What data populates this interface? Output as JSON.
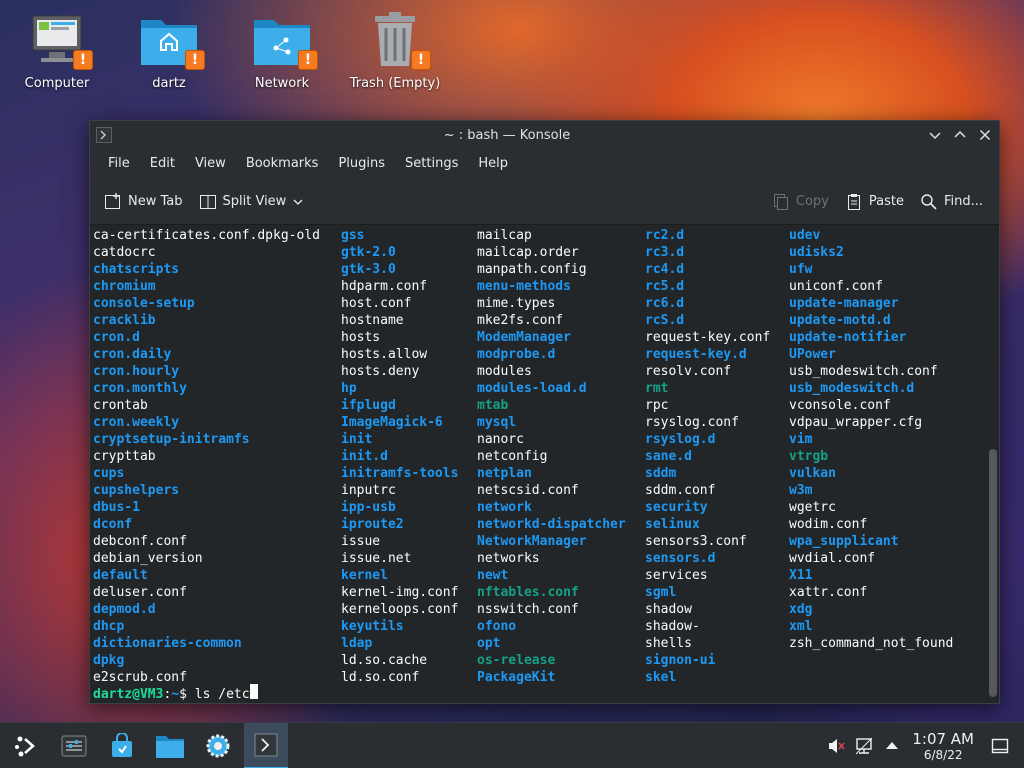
{
  "desktop": {
    "icons": [
      {
        "label": "Computer"
      },
      {
        "label": "dartz"
      },
      {
        "label": "Network"
      },
      {
        "label": "Trash (Empty)"
      }
    ],
    "badge_glyph": "!"
  },
  "window": {
    "title": "~ : bash — Konsole",
    "menu": [
      "File",
      "Edit",
      "View",
      "Bookmarks",
      "Plugins",
      "Settings",
      "Help"
    ],
    "toolbar": {
      "new_tab": "New Tab",
      "split_view": "Split View",
      "copy": "Copy",
      "paste": "Paste",
      "find": "Find..."
    }
  },
  "terminal": {
    "columns": [
      [
        {
          "t": "ca-certificates.conf.dpkg-old",
          "k": "plain"
        },
        {
          "t": "catdocrc",
          "k": "plain"
        },
        {
          "t": "chatscripts",
          "k": "dir"
        },
        {
          "t": "chromium",
          "k": "dir"
        },
        {
          "t": "console-setup",
          "k": "dir"
        },
        {
          "t": "cracklib",
          "k": "dir"
        },
        {
          "t": "cron.d",
          "k": "dir"
        },
        {
          "t": "cron.daily",
          "k": "dir"
        },
        {
          "t": "cron.hourly",
          "k": "dir"
        },
        {
          "t": "cron.monthly",
          "k": "dir"
        },
        {
          "t": "crontab",
          "k": "plain"
        },
        {
          "t": "cron.weekly",
          "k": "dir"
        },
        {
          "t": "cryptsetup-initramfs",
          "k": "dir"
        },
        {
          "t": "crypttab",
          "k": "plain"
        },
        {
          "t": "cups",
          "k": "dir"
        },
        {
          "t": "cupshelpers",
          "k": "dir"
        },
        {
          "t": "dbus-1",
          "k": "dir"
        },
        {
          "t": "dconf",
          "k": "dir"
        },
        {
          "t": "debconf.conf",
          "k": "plain"
        },
        {
          "t": "debian_version",
          "k": "plain"
        },
        {
          "t": "default",
          "k": "dir"
        },
        {
          "t": "deluser.conf",
          "k": "plain"
        },
        {
          "t": "depmod.d",
          "k": "dir"
        },
        {
          "t": "dhcp",
          "k": "dir"
        },
        {
          "t": "dictionaries-common",
          "k": "dir"
        },
        {
          "t": "dpkg",
          "k": "dir"
        },
        {
          "t": "e2scrub.conf",
          "k": "plain"
        }
      ],
      [
        {
          "t": "gss",
          "k": "dir"
        },
        {
          "t": "gtk-2.0",
          "k": "dir"
        },
        {
          "t": "gtk-3.0",
          "k": "dir"
        },
        {
          "t": "hdparm.conf",
          "k": "plain"
        },
        {
          "t": "host.conf",
          "k": "plain"
        },
        {
          "t": "hostname",
          "k": "plain"
        },
        {
          "t": "hosts",
          "k": "plain"
        },
        {
          "t": "hosts.allow",
          "k": "plain"
        },
        {
          "t": "hosts.deny",
          "k": "plain"
        },
        {
          "t": "hp",
          "k": "dir"
        },
        {
          "t": "ifplugd",
          "k": "dir"
        },
        {
          "t": "ImageMagick-6",
          "k": "dir"
        },
        {
          "t": "init",
          "k": "dir"
        },
        {
          "t": "init.d",
          "k": "dir"
        },
        {
          "t": "initramfs-tools",
          "k": "dir"
        },
        {
          "t": "inputrc",
          "k": "plain"
        },
        {
          "t": "ipp-usb",
          "k": "dir"
        },
        {
          "t": "iproute2",
          "k": "dir"
        },
        {
          "t": "issue",
          "k": "plain"
        },
        {
          "t": "issue.net",
          "k": "plain"
        },
        {
          "t": "kernel",
          "k": "dir"
        },
        {
          "t": "kernel-img.conf",
          "k": "plain"
        },
        {
          "t": "kerneloops.conf",
          "k": "plain"
        },
        {
          "t": "keyutils",
          "k": "dir"
        },
        {
          "t": "ldap",
          "k": "dir"
        },
        {
          "t": "ld.so.cache",
          "k": "plain"
        },
        {
          "t": "ld.so.conf",
          "k": "plain"
        }
      ],
      [
        {
          "t": "mailcap",
          "k": "plain"
        },
        {
          "t": "mailcap.order",
          "k": "plain"
        },
        {
          "t": "manpath.config",
          "k": "plain"
        },
        {
          "t": "menu-methods",
          "k": "dir"
        },
        {
          "t": "mime.types",
          "k": "plain"
        },
        {
          "t": "mke2fs.conf",
          "k": "plain"
        },
        {
          "t": "ModemManager",
          "k": "dir"
        },
        {
          "t": "modprobe.d",
          "k": "dir"
        },
        {
          "t": "modules",
          "k": "plain"
        },
        {
          "t": "modules-load.d",
          "k": "dir"
        },
        {
          "t": "mtab",
          "k": "cyan"
        },
        {
          "t": "mysql",
          "k": "dir"
        },
        {
          "t": "nanorc",
          "k": "plain"
        },
        {
          "t": "netconfig",
          "k": "plain"
        },
        {
          "t": "netplan",
          "k": "dir"
        },
        {
          "t": "netscsid.conf",
          "k": "plain"
        },
        {
          "t": "network",
          "k": "dir"
        },
        {
          "t": "networkd-dispatcher",
          "k": "dir"
        },
        {
          "t": "NetworkManager",
          "k": "dir"
        },
        {
          "t": "networks",
          "k": "plain"
        },
        {
          "t": "newt",
          "k": "dir"
        },
        {
          "t": "nftables.conf",
          "k": "cyan"
        },
        {
          "t": "nsswitch.conf",
          "k": "plain"
        },
        {
          "t": "ofono",
          "k": "dir"
        },
        {
          "t": "opt",
          "k": "dir"
        },
        {
          "t": "os-release",
          "k": "cyan"
        },
        {
          "t": "PackageKit",
          "k": "dir"
        }
      ],
      [
        {
          "t": "rc2.d",
          "k": "dir"
        },
        {
          "t": "rc3.d",
          "k": "dir"
        },
        {
          "t": "rc4.d",
          "k": "dir"
        },
        {
          "t": "rc5.d",
          "k": "dir"
        },
        {
          "t": "rc6.d",
          "k": "dir"
        },
        {
          "t": "rcS.d",
          "k": "dir"
        },
        {
          "t": "request-key.conf",
          "k": "plain"
        },
        {
          "t": "request-key.d",
          "k": "dir"
        },
        {
          "t": "resolv.conf",
          "k": "plain"
        },
        {
          "t": "rmt",
          "k": "cyan"
        },
        {
          "t": "rpc",
          "k": "plain"
        },
        {
          "t": "rsyslog.conf",
          "k": "plain"
        },
        {
          "t": "rsyslog.d",
          "k": "dir"
        },
        {
          "t": "sane.d",
          "k": "dir"
        },
        {
          "t": "sddm",
          "k": "dir"
        },
        {
          "t": "sddm.conf",
          "k": "plain"
        },
        {
          "t": "security",
          "k": "dir"
        },
        {
          "t": "selinux",
          "k": "dir"
        },
        {
          "t": "sensors3.conf",
          "k": "plain"
        },
        {
          "t": "sensors.d",
          "k": "dir"
        },
        {
          "t": "services",
          "k": "plain"
        },
        {
          "t": "sgml",
          "k": "dir"
        },
        {
          "t": "shadow",
          "k": "plain"
        },
        {
          "t": "shadow-",
          "k": "plain"
        },
        {
          "t": "shells",
          "k": "plain"
        },
        {
          "t": "signon-ui",
          "k": "dir"
        },
        {
          "t": "skel",
          "k": "dir"
        }
      ],
      [
        {
          "t": "udev",
          "k": "dir"
        },
        {
          "t": "udisks2",
          "k": "dir"
        },
        {
          "t": "ufw",
          "k": "dir"
        },
        {
          "t": "uniconf.conf",
          "k": "plain"
        },
        {
          "t": "update-manager",
          "k": "dir"
        },
        {
          "t": "update-motd.d",
          "k": "dir"
        },
        {
          "t": "update-notifier",
          "k": "dir"
        },
        {
          "t": "UPower",
          "k": "dir"
        },
        {
          "t": "usb_modeswitch.conf",
          "k": "plain"
        },
        {
          "t": "usb_modeswitch.d",
          "k": "dir"
        },
        {
          "t": "vconsole.conf",
          "k": "plain"
        },
        {
          "t": "vdpau_wrapper.cfg",
          "k": "plain"
        },
        {
          "t": "vim",
          "k": "dir"
        },
        {
          "t": "vtrgb",
          "k": "cyan"
        },
        {
          "t": "vulkan",
          "k": "dir"
        },
        {
          "t": "w3m",
          "k": "dir"
        },
        {
          "t": "wgetrc",
          "k": "plain"
        },
        {
          "t": "wodim.conf",
          "k": "plain"
        },
        {
          "t": "wpa_supplicant",
          "k": "dir"
        },
        {
          "t": "wvdial.conf",
          "k": "plain"
        },
        {
          "t": "X11",
          "k": "dir"
        },
        {
          "t": "xattr.conf",
          "k": "plain"
        },
        {
          "t": "xdg",
          "k": "dir"
        },
        {
          "t": "xml",
          "k": "dir"
        },
        {
          "t": "zsh_command_not_found",
          "k": "plain"
        },
        {
          "t": "",
          "k": "plain"
        },
        {
          "t": "",
          "k": "plain"
        }
      ]
    ],
    "prompt": {
      "user_host": "dartz@VM3",
      "sep": ":",
      "path": "~",
      "symbol": "$ ",
      "command": "ls /etc"
    }
  },
  "taskbar": {
    "clock_time": "1:07 AM",
    "clock_date": "6/8/22"
  },
  "colors": {
    "dir": "#1d99f3",
    "cyan": "#16a085",
    "plain": "#fcfcfc",
    "prompt_user": "#1cdc9a",
    "badge": "#f47b20"
  }
}
